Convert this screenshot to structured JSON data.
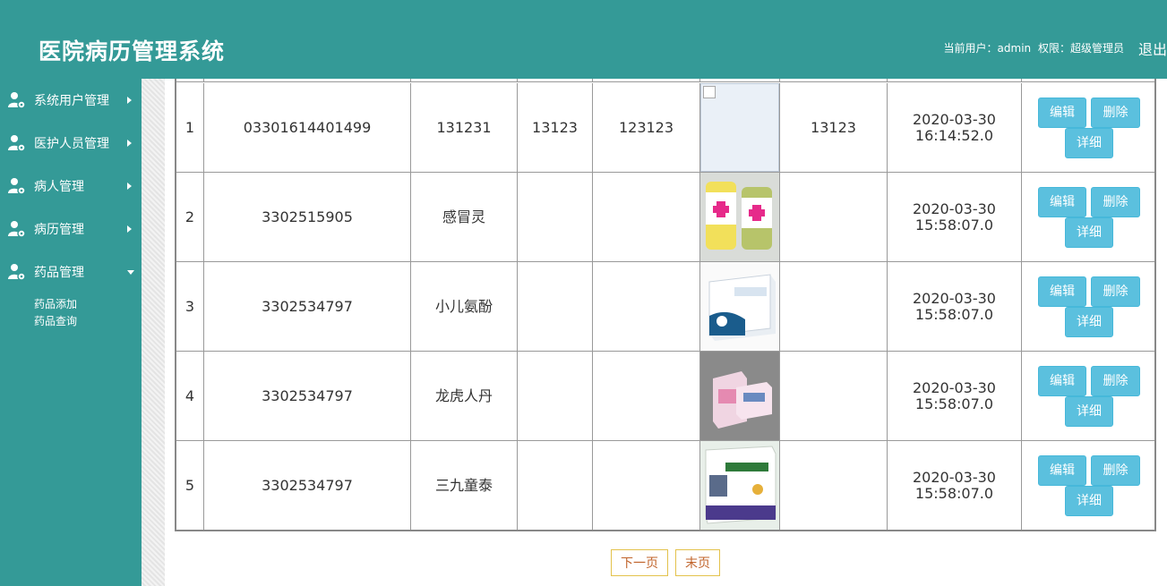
{
  "header": {
    "title": "医院病历管理系统",
    "current_user_label": "当前用户：admin",
    "role_label": "权限：超级管理员",
    "logout": "退出"
  },
  "sidebar": {
    "items": [
      {
        "label": "系统用户管理",
        "expanded": false
      },
      {
        "label": "医护人员管理",
        "expanded": false
      },
      {
        "label": "病人管理",
        "expanded": false
      },
      {
        "label": "病历管理",
        "expanded": false
      },
      {
        "label": "药品管理",
        "expanded": true
      }
    ],
    "subitems": [
      "药品添加",
      "药品查询"
    ]
  },
  "table": {
    "rows": [
      {
        "index": "1",
        "code": "03301614401499",
        "name": "131231",
        "col3": "13123",
        "col4": "123123",
        "image": "broken-image-icon",
        "col6": "13123",
        "date": "2020-03-30",
        "time": "16:14:52.0"
      },
      {
        "index": "2",
        "code": "3302515905",
        "name": "感冒灵",
        "col3": "",
        "col4": "",
        "image": "pill-bottles",
        "col6": "",
        "date": "2020-03-30",
        "time": "15:58:07.0"
      },
      {
        "index": "3",
        "code": "3302534797",
        "name": "小儿氨酚",
        "col3": "",
        "col4": "",
        "image": "medicine-box",
        "col6": "",
        "date": "2020-03-30",
        "time": "15:58:07.0"
      },
      {
        "index": "4",
        "code": "3302534797",
        "name": "龙虎人丹",
        "col3": "",
        "col4": "",
        "image": "pink-boxes",
        "col6": "",
        "date": "2020-03-30",
        "time": "15:58:07.0"
      },
      {
        "index": "5",
        "code": "3302534797",
        "name": "三九童泰",
        "col3": "",
        "col4": "",
        "image": "purple-box",
        "col6": "",
        "date": "2020-03-30",
        "time": "15:58:07.0"
      }
    ],
    "actions": {
      "edit": "编辑",
      "delete": "删除",
      "detail": "详细"
    }
  },
  "pager": {
    "next": "下一页",
    "last": "末页"
  },
  "colors": {
    "primary": "#349a97",
    "button": "#5bc0de",
    "pager_border": "#e3c24c",
    "pager_text": "#c0632a"
  }
}
